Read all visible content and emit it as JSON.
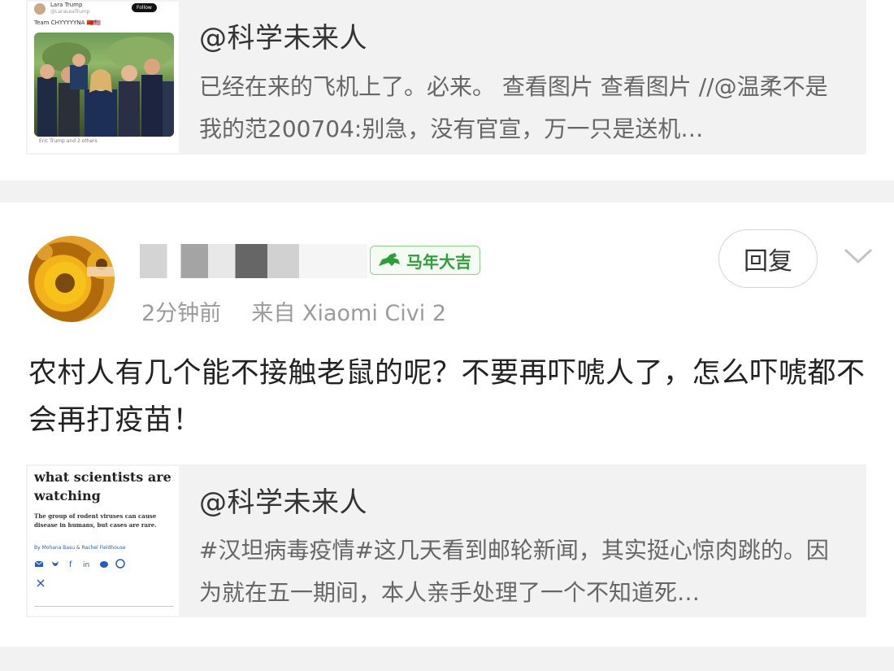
{
  "top_repost": {
    "author": "@科学未来人",
    "text": "已经在来的飞机上了。必来。 查看图片 查看图片 //@温柔不是我的范200704:别急，没有官宣，万一只是送机…",
    "thumb": {
      "account": "Lara Trump",
      "handle": "@LaraLeaTrump",
      "follow": "Follow",
      "caption": "Team CHYYYYYNA 🇨🇳🇺🇸",
      "tagged": "Eric Trump and 2 others"
    }
  },
  "post": {
    "username": "",
    "badge": "马年大吉",
    "time": "2分钟前",
    "source": "来自 Xiaomi Civi 2",
    "reply": "回复",
    "content": "农村人有几个能不接触老鼠的呢？不要再吓唬人了，怎么吓唬都不会再打疫苗！"
  },
  "bottom_repost": {
    "author": "@科学未来人",
    "text": "#汉坦病毒疫情#这几天看到邮轮新闻，其实挺心惊肉跳的。因为就在五一期间，本人亲手处理了一个不知道死…",
    "thumb": {
      "headline": "what scientists are watching",
      "dek": "The group of rodent viruses can cause disease in humans, but cases are rare.",
      "byline": "By Mohana Basu & Rachel Fieldhouse"
    }
  },
  "colors": {
    "divider": "#f2f2f2",
    "card_bg": "#f2f2f2",
    "badge_green": "#2f9d3a",
    "muted_text": "#9b9b9b"
  }
}
